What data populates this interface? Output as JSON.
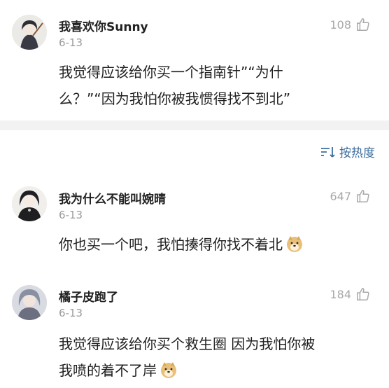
{
  "comments": [
    {
      "username": "我喜欢你Sunny",
      "date": "6-13",
      "likes": "108",
      "lines": [
        "我觉得应该给你买一个指南针”“为什",
        "么？”“因为我怕你被我惯得找不到北”"
      ]
    },
    {
      "username": "我为什么不能叫婉晴",
      "date": "6-13",
      "likes": "647",
      "lines": [
        "你也买一个吧，我怕揍得你找不着北"
      ],
      "emoji": "doge-emoji"
    },
    {
      "username": "橘子皮跑了",
      "date": "6-13",
      "likes": "184",
      "lines": [
        "我觉得应该给你买个救生圈 因为我怕你被",
        "我喷的着不了岸"
      ],
      "emoji": "doge-emoji"
    }
  ],
  "sort": {
    "label": "按热度",
    "icon": "sort-icon"
  },
  "colors": {
    "link": "#3d6e9e",
    "muted": "#9a9a9a",
    "divider": "#f2f2f2"
  }
}
